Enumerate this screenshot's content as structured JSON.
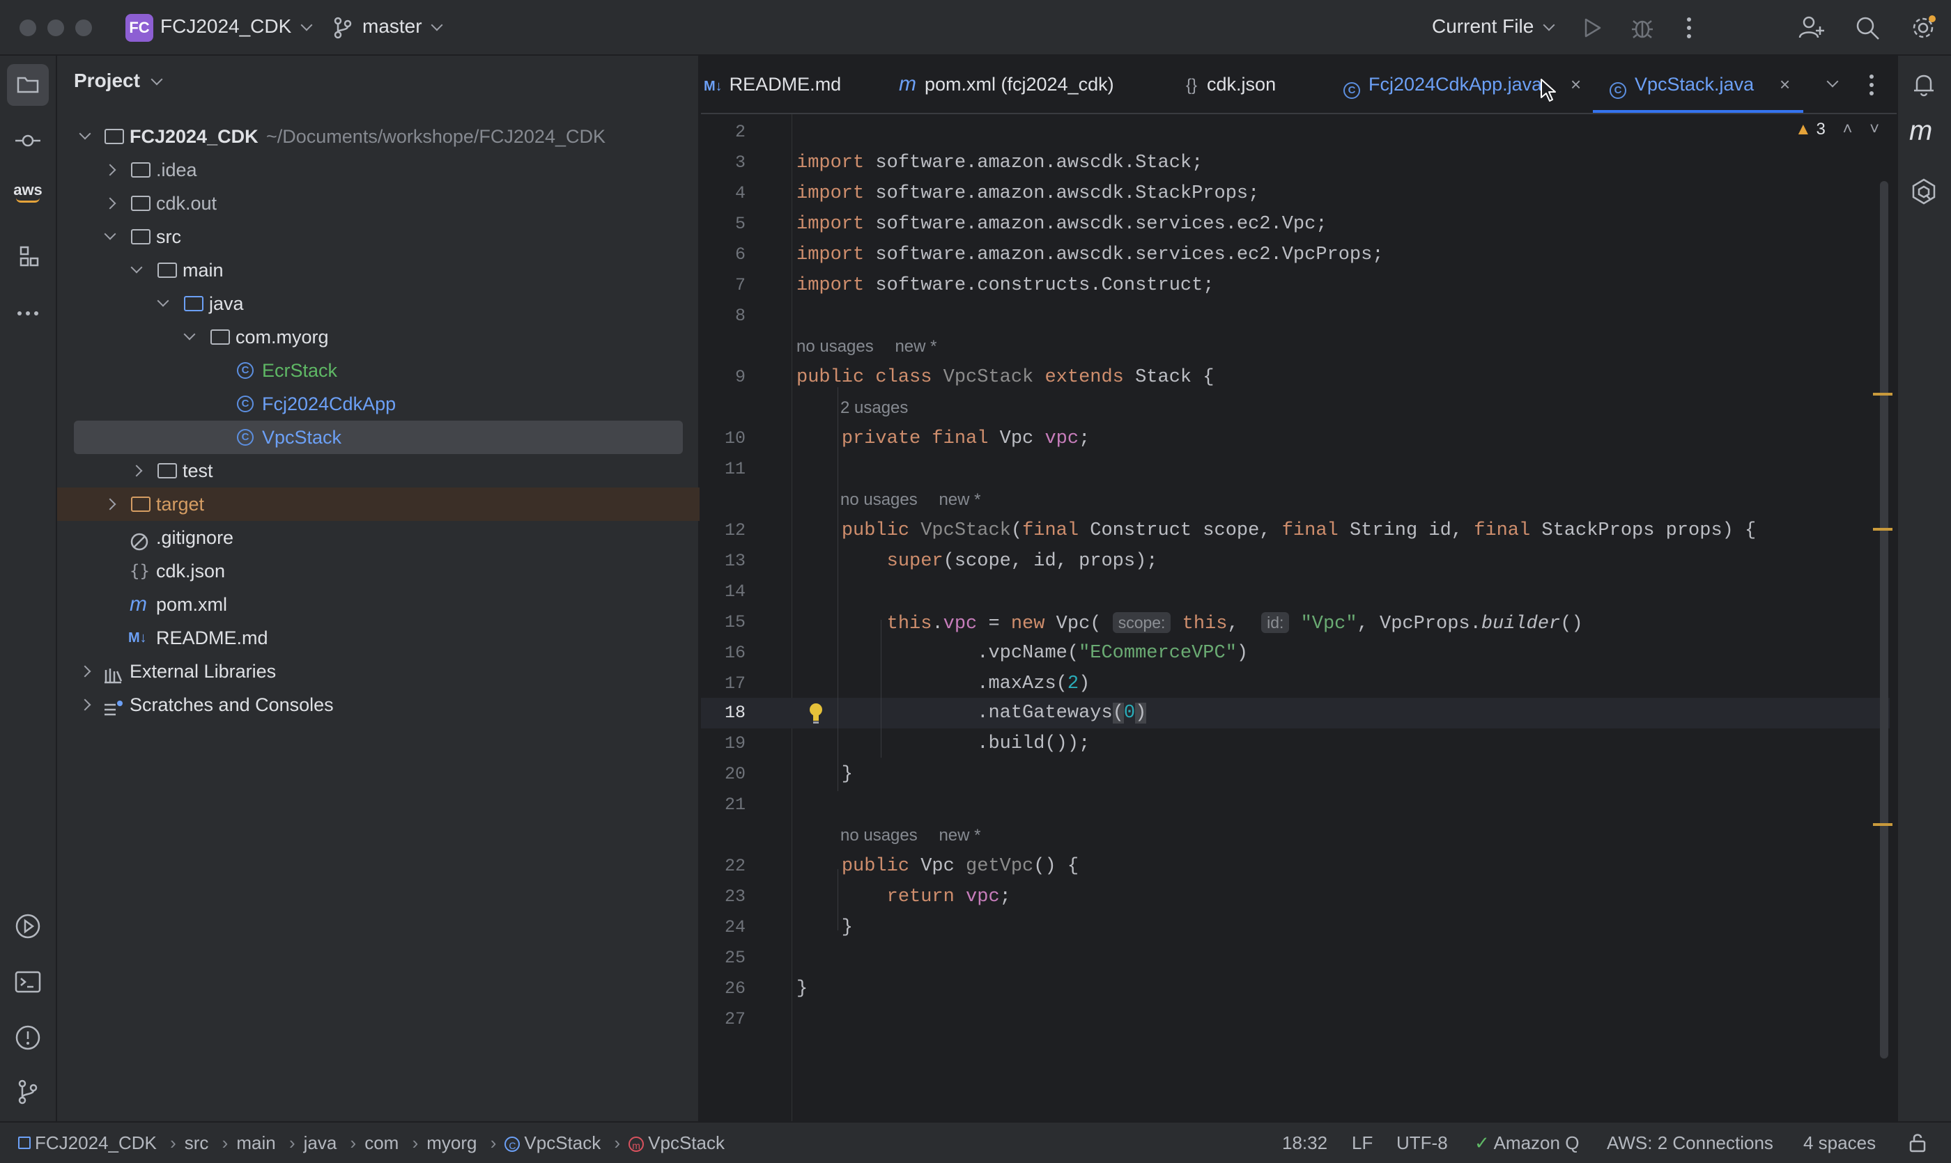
{
  "titlebar": {
    "project_badge": "FC",
    "project_name": "FCJ2024_CDK",
    "branch": "master",
    "run_config": "Current File"
  },
  "project_panel": {
    "title": "Project",
    "root_name": "FCJ2024_CDK",
    "root_path": "~/Documents/workshope/FCJ2024_CDK",
    "items": [
      {
        "label": ".idea"
      },
      {
        "label": "cdk.out"
      },
      {
        "label": "src"
      },
      {
        "label": "main"
      },
      {
        "label": "java"
      },
      {
        "label": "com.myorg"
      },
      {
        "label": "EcrStack"
      },
      {
        "label": "Fcj2024CdkApp"
      },
      {
        "label": "VpcStack"
      },
      {
        "label": "test"
      },
      {
        "label": "target"
      },
      {
        "label": ".gitignore"
      },
      {
        "label": "cdk.json"
      },
      {
        "label": "pom.xml"
      },
      {
        "label": "README.md"
      },
      {
        "label": "External Libraries"
      },
      {
        "label": "Scratches and Consoles"
      }
    ]
  },
  "tabs": [
    {
      "icon": "M↓",
      "label": "README.md"
    },
    {
      "icon": "m",
      "label": "pom.xml (fcj2024_cdk)"
    },
    {
      "icon": "{}",
      "label": "cdk.json"
    },
    {
      "icon": "C",
      "label": "Fcj2024CdkApp.java"
    },
    {
      "icon": "C",
      "label": "VpcStack.java"
    }
  ],
  "editor": {
    "warning_count": "3",
    "line_numbers": [
      "2",
      "3",
      "4",
      "5",
      "6",
      "7",
      "8",
      "9",
      "10",
      "11",
      "12",
      "13",
      "14",
      "15",
      "16",
      "17",
      "18",
      "19",
      "20",
      "21",
      "22",
      "23",
      "24",
      "25",
      "26",
      "27"
    ],
    "hints": {
      "class_usages": "no usages",
      "class_new": "new *",
      "field_usages": "2 usages",
      "ctor_usages": "no usages",
      "ctor_new": "new *",
      "getter_usages": "no usages",
      "getter_new": "new *",
      "inlay_scope": "scope:",
      "inlay_id": "id:"
    }
  },
  "statusbar": {
    "breadcrumbs": [
      "FCJ2024_CDK",
      "src",
      "main",
      "java",
      "com",
      "myorg",
      "VpcStack",
      "VpcStack"
    ],
    "position": "18:32",
    "line_ending": "LF",
    "encoding": "UTF-8",
    "amazon_q": "Amazon Q",
    "aws": "AWS: 2 Connections",
    "indent": "4 spaces"
  }
}
